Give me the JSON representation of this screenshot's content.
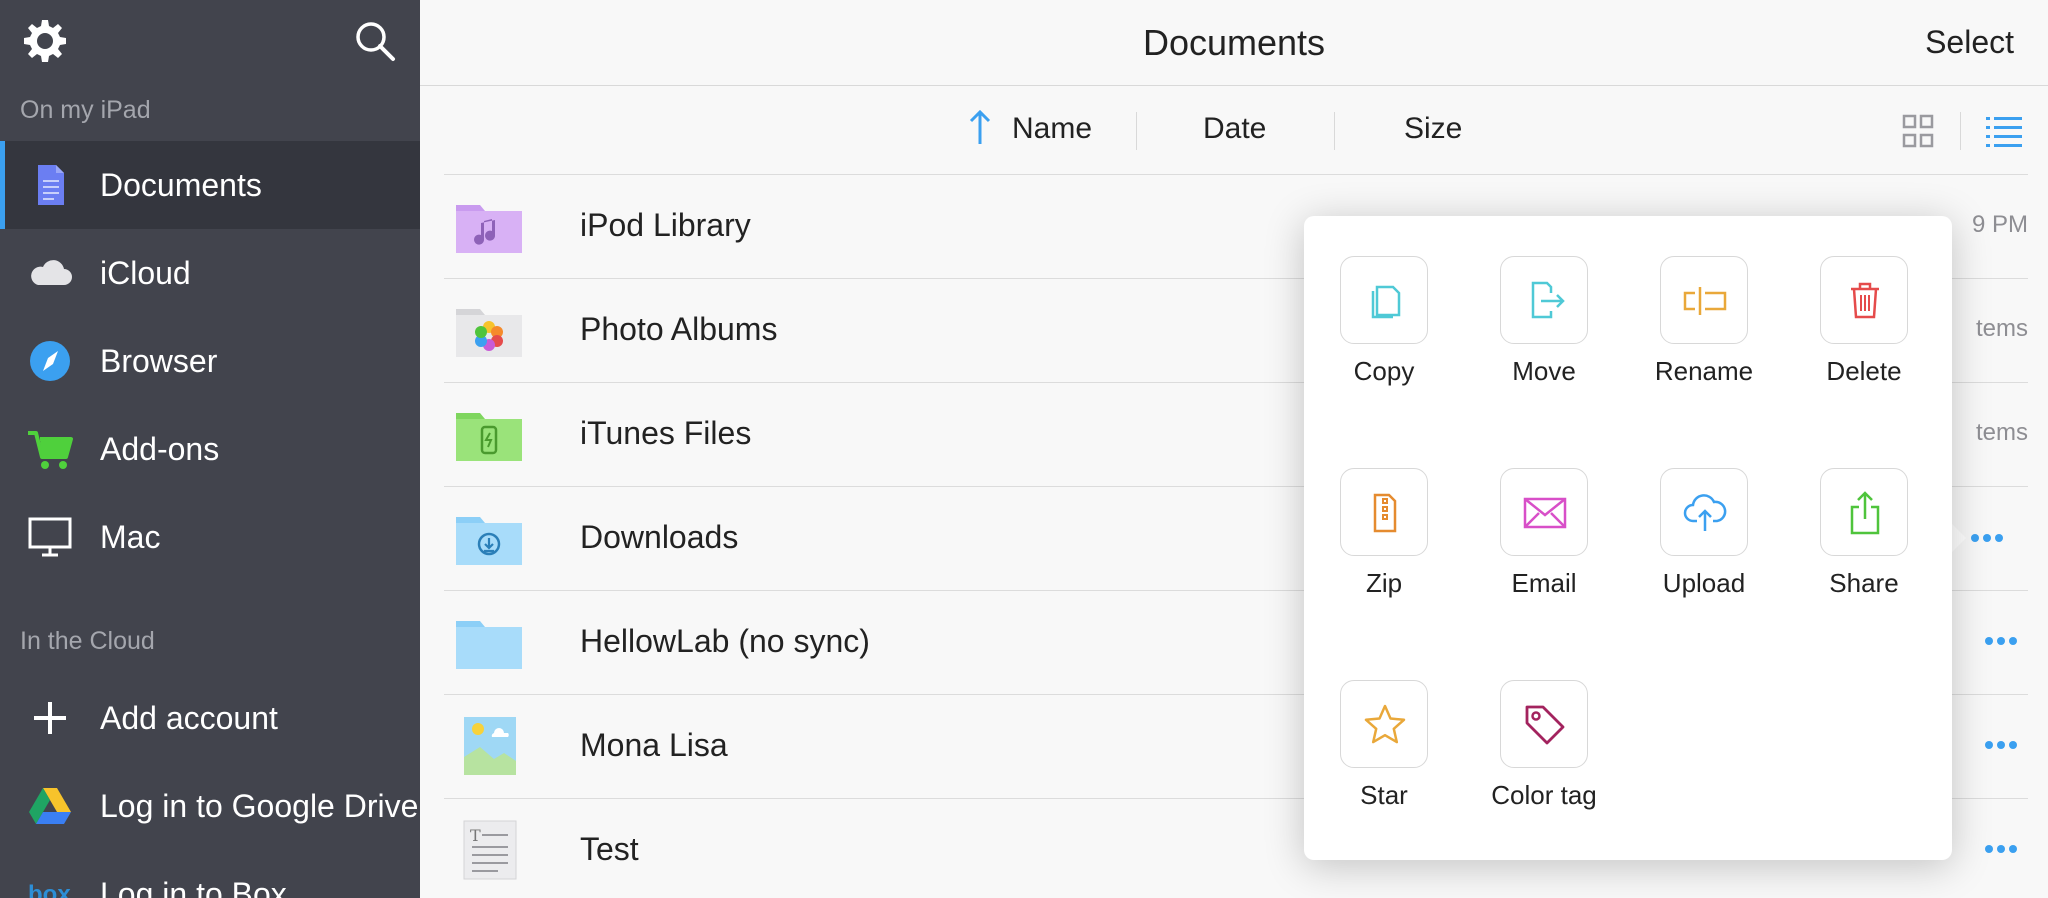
{
  "sidebar": {
    "section_local": "On my iPad",
    "section_cloud": "In the Cloud",
    "items": [
      {
        "label": "Documents",
        "icon": "document-icon"
      },
      {
        "label": "iCloud",
        "icon": "cloud-icon"
      },
      {
        "label": "Browser",
        "icon": "compass-icon"
      },
      {
        "label": "Add-ons",
        "icon": "cart-icon"
      },
      {
        "label": "Mac",
        "icon": "monitor-icon"
      }
    ],
    "cloud_items": [
      {
        "label": "Add account",
        "icon": "plus-icon"
      },
      {
        "label": "Log in to Google Drive",
        "icon": "google-drive-icon"
      },
      {
        "label": "Log in to Box",
        "icon": "box-icon"
      }
    ]
  },
  "header": {
    "title": "Documents",
    "select_label": "Select"
  },
  "sort": {
    "name": "Name",
    "date": "Date",
    "size": "Size"
  },
  "files": [
    {
      "name": "iPod Library",
      "meta": "9 PM"
    },
    {
      "name": "Photo Albums",
      "meta": "tems"
    },
    {
      "name": "iTunes Files",
      "meta": "tems"
    },
    {
      "name": "Downloads",
      "meta": ""
    },
    {
      "name": "HellowLab (no sync)",
      "meta": ""
    },
    {
      "name": "Mona Lisa",
      "meta": ""
    },
    {
      "name": "Test",
      "meta": ""
    }
  ],
  "actions": [
    {
      "label": "Copy",
      "icon": "copy-icon",
      "color": "#4fc9d6"
    },
    {
      "label": "Move",
      "icon": "move-icon",
      "color": "#4fc9d6"
    },
    {
      "label": "Rename",
      "icon": "rename-icon",
      "color": "#e9a83a"
    },
    {
      "label": "Delete",
      "icon": "trash-icon",
      "color": "#e54b4b"
    },
    {
      "label": "Zip",
      "icon": "zip-icon",
      "color": "#e58b2f"
    },
    {
      "label": "Email",
      "icon": "email-icon",
      "color": "#d84fc8"
    },
    {
      "label": "Upload",
      "icon": "upload-icon",
      "color": "#3ba0f0"
    },
    {
      "label": "Share",
      "icon": "share-icon",
      "color": "#4fc43c"
    },
    {
      "label": "Star",
      "icon": "star-icon",
      "color": "#e9a83a"
    },
    {
      "label": "Color tag",
      "icon": "tag-icon",
      "color": "#a3235e"
    }
  ],
  "colors": {
    "sidebar_bg": "#42444d",
    "accent": "#3ba0f0"
  }
}
